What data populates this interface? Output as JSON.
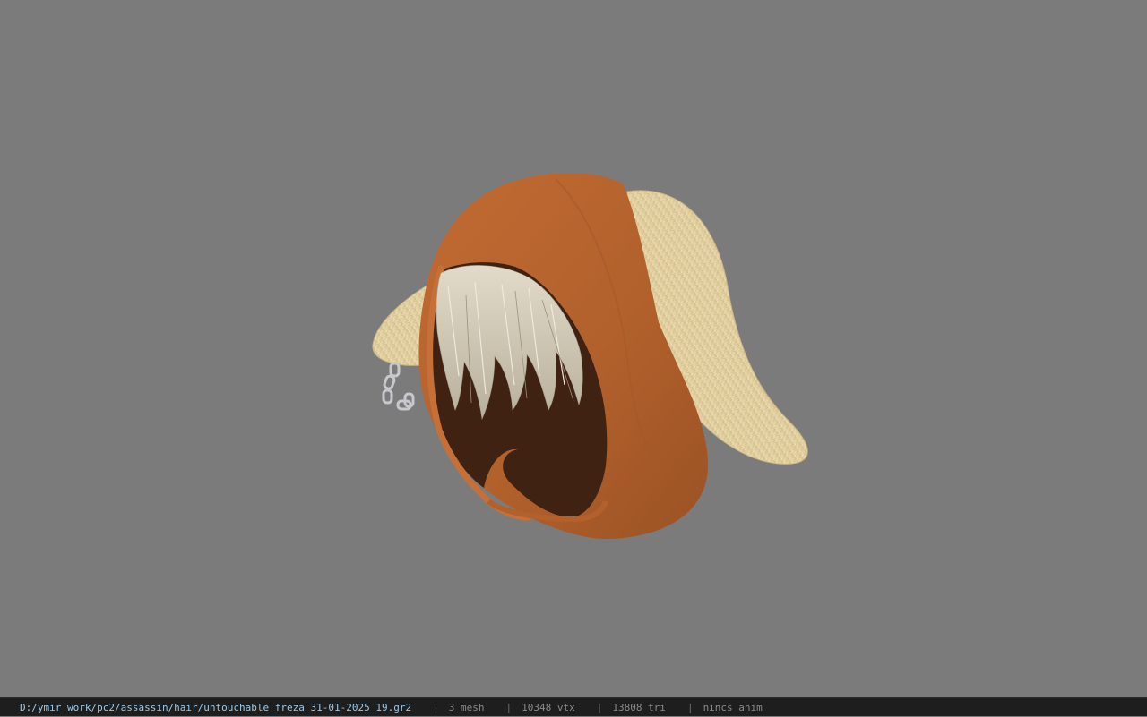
{
  "viewport": {
    "background": "#7b7b7b",
    "model_parts": [
      "hood",
      "hair",
      "horn-left",
      "horn-right",
      "chain"
    ],
    "colors": {
      "hood": "#b2612c",
      "hood_inner": "#3f2212",
      "hair": "#d4ccb8",
      "horn": "#e9d8aa",
      "chain": "#c8c8cc"
    }
  },
  "statusbar": {
    "file_path": "D:/ymir work/pc2/assassin/hair/untouchable_freza_31-01-2025_19.gr2",
    "separator": "|",
    "mesh_count": "3 mesh",
    "vertex_count": "10348 vtx",
    "triangle_count": "13808 tri",
    "anim_status": "nincs anim",
    "path_color": "#9fc7e6"
  }
}
